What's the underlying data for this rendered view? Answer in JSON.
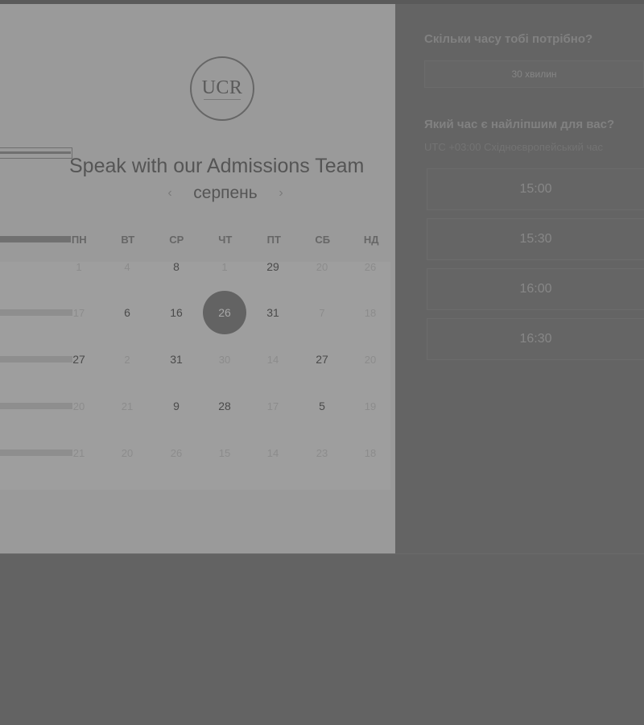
{
  "booking": {
    "title": "Speak with our Admissions Team",
    "logo_text": "UCR",
    "month": "серпень",
    "prev_icon": "chevron-left-icon",
    "next_icon": "chevron-right-icon",
    "weekdays": [
      "ПН",
      "ВТ",
      "СР",
      "ЧТ",
      "ПТ",
      "СБ",
      "НД"
    ],
    "days": [
      [
        "1",
        "4",
        "8",
        "1",
        "29",
        "20",
        "26"
      ],
      [
        "17",
        "6",
        "16",
        "26",
        "31",
        "7",
        "18"
      ],
      [
        "27",
        "2",
        "31",
        "30",
        "14",
        "27",
        "20"
      ],
      [
        "20",
        "21",
        "9",
        "28",
        "17",
        "5",
        "19"
      ],
      [
        "21",
        "20",
        "26",
        "15",
        "14",
        "23",
        "18"
      ]
    ],
    "available_days": [
      "8",
      "29",
      "6",
      "16",
      "31",
      "27",
      "9",
      "28",
      "5"
    ],
    "selected_day": "26"
  },
  "scheduler": {
    "duration_question": "Скільки часу тобі потрібно?",
    "duration_value": "30 хвилин",
    "time_question": "Який час є найліпшим для вас?",
    "timezone": "UTC +03:00 Східноєвропейський час",
    "slots": [
      "15:00",
      "15:30",
      "16:00",
      "16:30"
    ]
  }
}
